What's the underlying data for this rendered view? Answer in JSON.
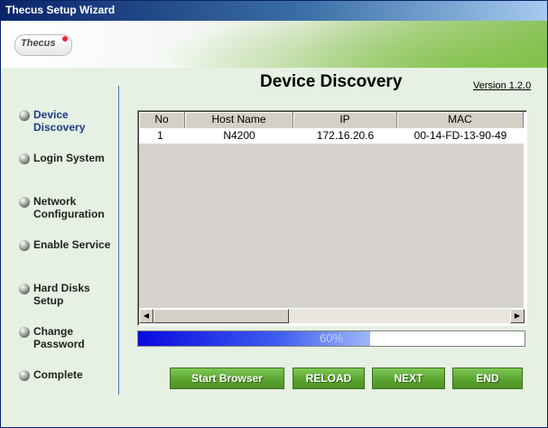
{
  "window": {
    "title": "Thecus Setup Wizard"
  },
  "banner": {
    "logo_text": "Thecus"
  },
  "sidebar": {
    "steps": [
      {
        "label": "Device Discovery",
        "active": true
      },
      {
        "label": "Login System"
      },
      {
        "label": "Network Configuration"
      },
      {
        "label": "Enable Service"
      },
      {
        "label": "Hard Disks Setup"
      },
      {
        "label": "Change Password"
      },
      {
        "label": "Complete"
      }
    ]
  },
  "main": {
    "heading": "Device Discovery",
    "version": "Version 1.2.0",
    "table": {
      "columns": [
        "No",
        "Host Name",
        "IP",
        "MAC"
      ],
      "rows": [
        {
          "no": "1",
          "host": "N4200",
          "ip": "172.16.20.6",
          "mac": "00-14-FD-13-90-49"
        }
      ]
    },
    "progress": {
      "value": 0.6,
      "label": "60%"
    },
    "buttons": {
      "start_browser": "Start Browser",
      "reload": "RELOAD",
      "next": "NEXT",
      "end": "END"
    }
  },
  "colors": {
    "accent_green": "#5aa42f",
    "progress_blue": "#0a0ae0",
    "title_blue": "#0a246a"
  }
}
